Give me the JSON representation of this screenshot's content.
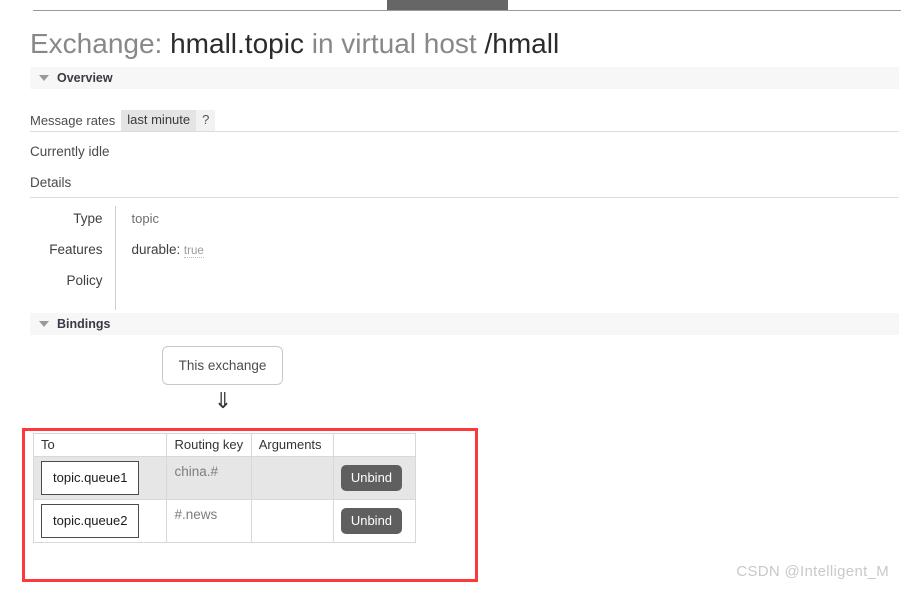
{
  "window": {
    "tab_placeholder": ""
  },
  "header": {
    "prefix": "Exchange: ",
    "exchange_name": "hmall.topic",
    "middle": " in virtual host ",
    "vhost": "/hmall"
  },
  "overview": {
    "section_label": "Overview",
    "message_rates_label": "Message rates",
    "rate_period": "last minute",
    "help_label": "?",
    "idle_text": "Currently idle",
    "details_label": "Details",
    "details": [
      {
        "key": "Type",
        "value": "topic"
      },
      {
        "key": "Features",
        "feature_key": "durable:",
        "feature_value": "true"
      },
      {
        "key": "Policy",
        "value": ""
      }
    ]
  },
  "bindings": {
    "section_label": "Bindings",
    "this_exchange_label": "This exchange",
    "arrow_glyph": "⇓",
    "columns": [
      "To",
      "Routing key",
      "Arguments",
      ""
    ],
    "rows": [
      {
        "to": "topic.queue1",
        "routing_key": "china.#",
        "arguments": "",
        "action": "Unbind"
      },
      {
        "to": "topic.queue2",
        "routing_key": "#.news",
        "arguments": "",
        "action": "Unbind"
      }
    ]
  },
  "annotation": {
    "highlight_color": "#fb3b3b"
  },
  "watermark": {
    "text": "CSDN @Intelligent_M"
  }
}
